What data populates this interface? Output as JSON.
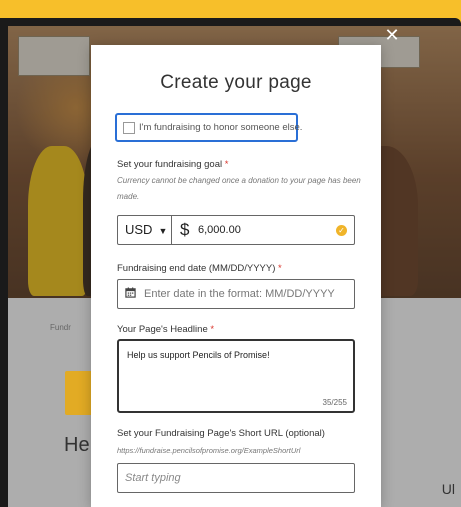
{
  "background_page": {
    "fundraise_label": "Fundr",
    "heading_fragment": "He",
    "corner_fragment": "Ul"
  },
  "modal": {
    "title": "Create your page",
    "close_icon": "close-icon",
    "honor_checkbox": {
      "label": "I'm fundraising to honor someone else.",
      "checked": false
    },
    "goal": {
      "label": "Set your fundraising goal",
      "required_mark": "*",
      "note": "Currency cannot be changed once a donation to your page has been made.",
      "currency": "USD",
      "currency_symbol": "$",
      "amount": "6,000.00",
      "valid_icon": "check-circle-icon"
    },
    "end_date": {
      "label": "Fundraising end date (MM/DD/YYYY)",
      "required_mark": "*",
      "placeholder": "Enter date in the format: MM/DD/YYYY",
      "icon": "calendar-icon"
    },
    "headline": {
      "label": "Your Page's Headline",
      "required_mark": "*",
      "value": "Help us support Pencils of Promise!",
      "counter": "35/255"
    },
    "short_url": {
      "label": "Set your Fundraising Page's Short URL (optional)",
      "hint": "https://fundraise.pencilsofpromise.org/ExampleShortUrl",
      "placeholder": "Start typing"
    }
  },
  "colors": {
    "frame_yellow": "#f7bf2a",
    "focus_blue": "#2a6fd6",
    "required_red": "#d9342b",
    "valid_orange": "#f0b429"
  }
}
